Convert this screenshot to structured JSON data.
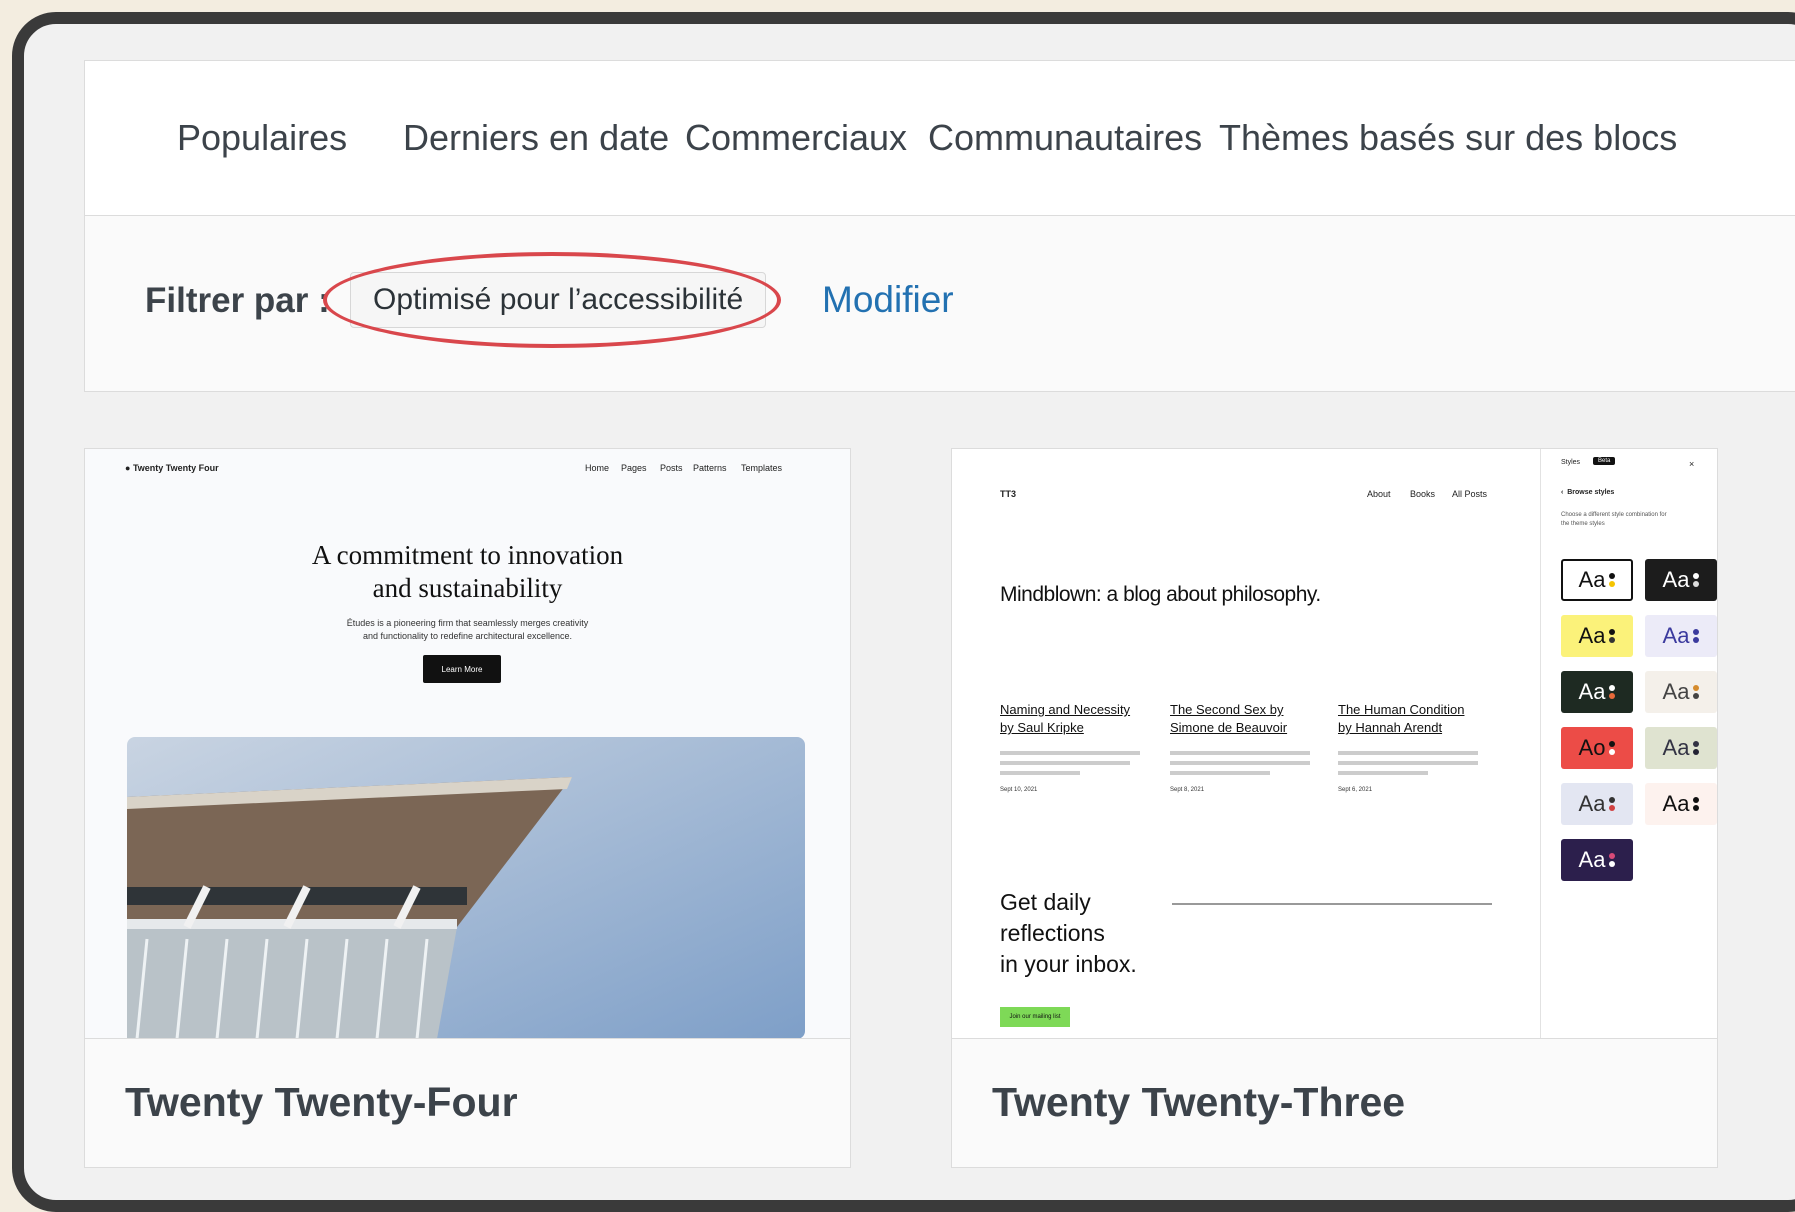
{
  "tabs": [
    "Populaires",
    "Derniers en date",
    "Commerciaux",
    "Communautaires",
    "Thèmes basés sur des blocs"
  ],
  "filter": {
    "label": "Filtrer par :",
    "tag": "Optimisé pour l’accessibilité",
    "modify": "Modifier"
  },
  "themes": [
    {
      "name": "Twenty Twenty-Four",
      "preview": {
        "site": "Twenty Twenty Four",
        "nav": [
          "Home",
          "Pages",
          "Posts",
          "Patterns",
          "Templates"
        ],
        "heading1": "A commitment to innovation",
        "heading2": "and sustainability",
        "body1": "Études is a pioneering firm that seamlessly merges creativity",
        "body2": "and functionality to redefine architectural excellence.",
        "button": "Learn More"
      }
    },
    {
      "name": "Twenty Twenty-Three",
      "preview": {
        "site": "TT3",
        "nav": [
          "About",
          "Books",
          "All Posts"
        ],
        "headline": "Mindblown: a blog about philosophy.",
        "posts": [
          {
            "title1": "Naming and Necessity",
            "title2": "by Saul Kripke",
            "date": "Sept 10, 2021"
          },
          {
            "title1": "The Second Sex by",
            "title2": "Simone de Beauvoir",
            "date": "Sept 8, 2021"
          },
          {
            "title1": "The Human Condition",
            "title2": "by Hannah Arendt",
            "date": "Sept 6, 2021"
          }
        ],
        "cta1": "Get daily",
        "cta2": "reflections",
        "cta3": "in your inbox.",
        "cta_button": "Join our mailing list",
        "panel_title": "Styles",
        "panel_badge": "Beta",
        "panel_back": "Browse styles",
        "panel_desc1": "Choose a different style combination for",
        "panel_desc2": "the theme styles",
        "style_label": "Aa",
        "style_label_alt": "Ao"
      }
    }
  ],
  "colors": {
    "accent": "#2271b1",
    "highlight_circle": "#d9474c",
    "text": "#3c434a"
  }
}
